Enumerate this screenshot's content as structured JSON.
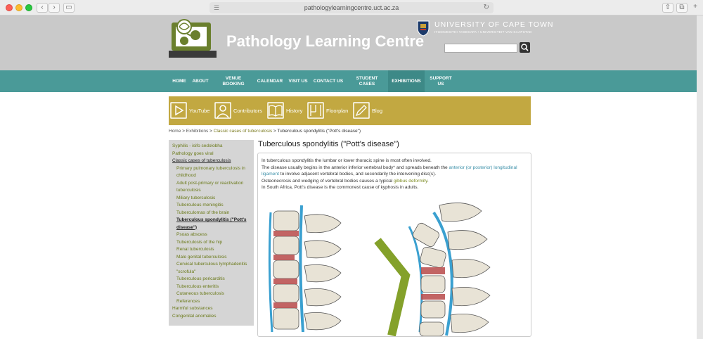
{
  "browser": {
    "url": "pathologylearningcentre.uct.ac.za",
    "back": "‹",
    "forward": "›"
  },
  "header": {
    "site_title": "Pathology Learning Centre",
    "university_name": "UNIVERSITY OF CAPE TOWN",
    "university_sub": "IYUNIVESITHI YASEKAPA • UNIVERSITEIT VAN KAAPSTAD",
    "search_placeholder": ""
  },
  "main_nav": [
    {
      "label": "HOME"
    },
    {
      "label": "ABOUT"
    },
    {
      "label": "VENUE\nBOOKING"
    },
    {
      "label": "CALENDAR"
    },
    {
      "label": "VISIT US"
    },
    {
      "label": "CONTACT US"
    },
    {
      "label": "STUDENT\nCASES"
    },
    {
      "label": "EXHIBITIONS"
    },
    {
      "label": "SUPPORT\nUS"
    }
  ],
  "sub_nav": [
    {
      "label": "YouTube",
      "icon": "play-icon"
    },
    {
      "label": "Contributors",
      "icon": "person-icon"
    },
    {
      "label": "History",
      "icon": "book-icon"
    },
    {
      "label": "Floorplan",
      "icon": "floorplan-icon"
    },
    {
      "label": "Blog",
      "icon": "pencil-icon"
    }
  ],
  "breadcrumb": {
    "home": "Home",
    "sep": " > ",
    "exhibitions": "Exhibitions",
    "section": "Classic cases of tuberculosis",
    "current": "Tuberculous spondylitis (\"Pott's disease\")"
  },
  "sidebar": [
    {
      "label": "Syphilis - isifo sedolobha",
      "level": 1
    },
    {
      "label": "Pathology goes viral",
      "level": 1
    },
    {
      "label": "Classic cases of tuberculosis",
      "level": 1,
      "state": "section"
    },
    {
      "label": "Primary pulmonary tuberculosis in childhood",
      "level": 2
    },
    {
      "label": "Adult post-primary or reactivation tuberculosis",
      "level": 2
    },
    {
      "label": "Miliary tuberculosis",
      "level": 2
    },
    {
      "label": "Tuberculous meningitis",
      "level": 2
    },
    {
      "label": "Tuberculomas of the brain",
      "level": 2
    },
    {
      "label": "Tuberculous spondylitis (\"Pott's disease\")",
      "level": 2,
      "state": "current"
    },
    {
      "label": "Psoas abscess",
      "level": 2
    },
    {
      "label": "Tuberculosis of the hip",
      "level": 2
    },
    {
      "label": "Renal tuberculosis",
      "level": 2
    },
    {
      "label": "Male genital tuberculosis",
      "level": 2
    },
    {
      "label": "Cervical tuberculous lymphadenitis \"scrofula\"",
      "level": 2
    },
    {
      "label": "Tuberculous pericarditis",
      "level": 2
    },
    {
      "label": "Tuberculous enteritis",
      "level": 2
    },
    {
      "label": "Cutaneous tuberculosis",
      "level": 2
    },
    {
      "label": "References",
      "level": 2
    },
    {
      "label": "Harmful substances",
      "level": 1
    },
    {
      "label": "Congenital anomalies",
      "level": 1
    }
  ],
  "content": {
    "title": "Tuberculous spondylitis (\"Pott's disease\")",
    "p1": "In tuberculous spondylitis the lumbar or lower thoracic spine is most often involved.",
    "p2_a": "The disease usually begins in the anterior inferior vertebral body* and spreads beneath the ",
    "p2_link": "anterior (or posterior) longitudinal ligament",
    "p2_b": " to involve adjacent vertebral bodies, and secondarily the intervening disc(s).",
    "p3_a": "Osteonecrosis and wedging of vertebral bodies causes a typical ",
    "p3_link": "gibbus deformity",
    "p3_b": ".",
    "p4": "In South Africa, Pott's disease is the commonest cause of kyphosis in adults."
  }
}
